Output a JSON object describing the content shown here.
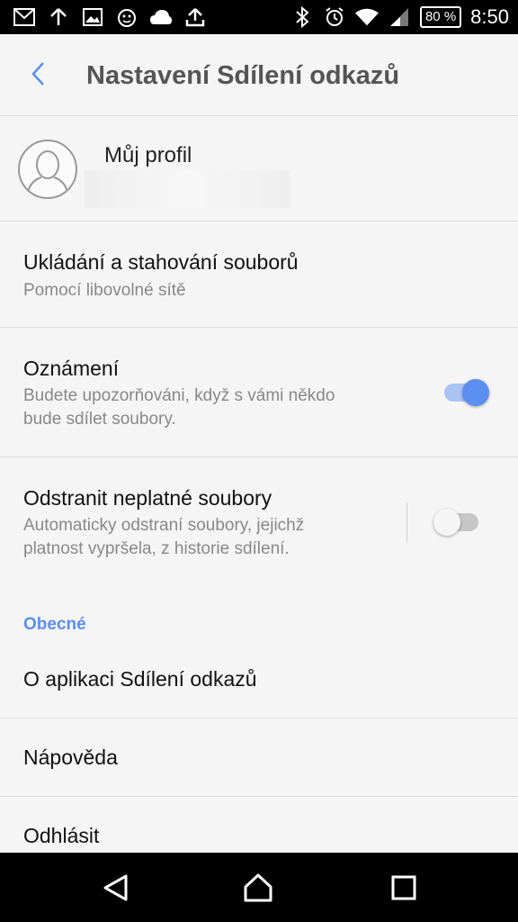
{
  "status_bar": {
    "time": "8:50",
    "battery": "80 %",
    "left_icons": [
      "gmail-icon",
      "upload-arrow-icon",
      "image-icon",
      "alarm-app-icon",
      "cloud-icon",
      "share-upload-icon"
    ],
    "right_icons": [
      "bluetooth-icon",
      "alarm-clock-icon",
      "wifi-icon",
      "signal-icon"
    ]
  },
  "app_bar": {
    "title": "Nastavení Sdílení odkazů"
  },
  "profile": {
    "name": "Můj profil"
  },
  "settings": {
    "storage": {
      "title": "Ukládání a stahování souborů",
      "subtitle": "Pomocí libovolné sítě"
    },
    "notifications": {
      "title": "Oznámení",
      "subtitle_line1": "Budete upozorňováni, když s vámi někdo",
      "subtitle_line2": "bude sdílet soubory.",
      "enabled": true
    },
    "remove_invalid": {
      "title": "Odstranit neplatné soubory",
      "subtitle_line1": "Automaticky odstraní soubory, jejichž",
      "subtitle_line2": "platnost vypršela, z historie sdílení.",
      "enabled": false
    }
  },
  "general": {
    "header": "Obecné",
    "about": "O aplikaci Sdílení odkazů",
    "help": "Nápověda",
    "logout": "Odhlásit"
  },
  "colors": {
    "accent": "#5b8ef0",
    "toggle_on_track": "#a9c3f5",
    "toggle_off_track": "#c6c6c6",
    "toggle_off_thumb": "#f5f5f5"
  }
}
